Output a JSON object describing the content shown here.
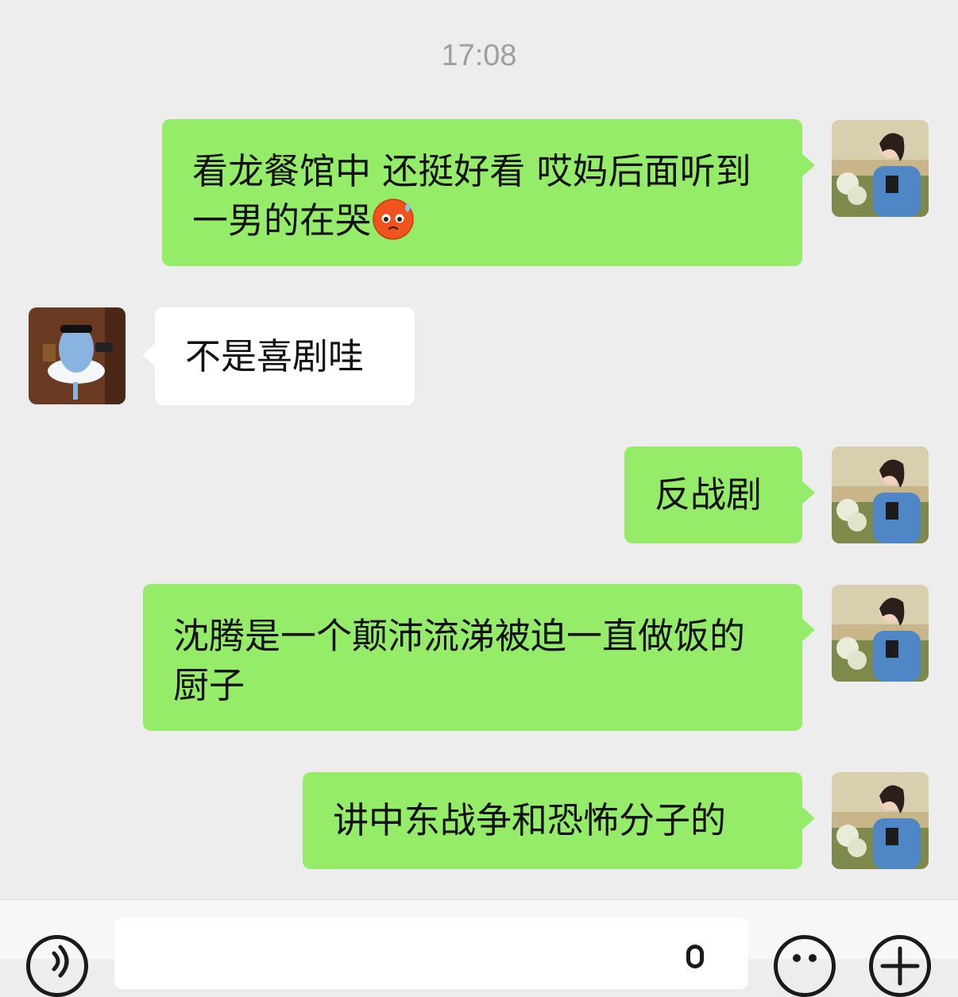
{
  "timestamp": "17:08",
  "messages": [
    {
      "sender": "self",
      "text": "看龙餐馆中 还挺好看 哎妈后面听到一男的在哭",
      "emoji": "sweat-face-emoji"
    },
    {
      "sender": "other",
      "text": "不是喜剧哇"
    },
    {
      "sender": "self",
      "text": "反战剧"
    },
    {
      "sender": "self",
      "text": "沈腾是一个颠沛流涕被迫一直做饭的厨子"
    },
    {
      "sender": "self",
      "text": "讲中东战争和恐怖分子的"
    }
  ],
  "input": {
    "placeholder": ""
  },
  "colors": {
    "self_bubble": "#95ec69",
    "other_bubble": "#ffffff",
    "background": "#ededed"
  },
  "icons": [
    "voice-icon",
    "emoji-icon",
    "plus-icon",
    "mic-icon"
  ]
}
